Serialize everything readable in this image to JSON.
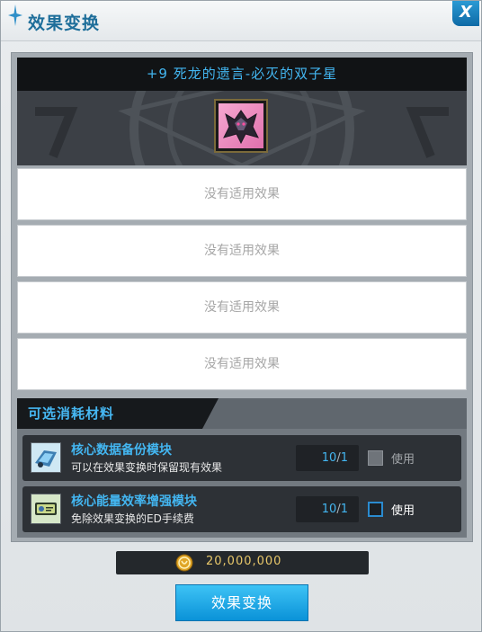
{
  "window": {
    "title": "效果变换",
    "close_label": "X"
  },
  "item": {
    "name": "+9 死龙的遗言-必灭的双子星",
    "icon": "dragon-emblem-icon"
  },
  "effect_slots": [
    {
      "text": "没有适用效果"
    },
    {
      "text": "没有适用效果"
    },
    {
      "text": "没有适用效果"
    },
    {
      "text": "没有适用效果"
    }
  ],
  "materials": {
    "title": "可选消耗材料",
    "items": [
      {
        "name": "核心数据备份模块",
        "description": "可以在效果变换时保留现有效果",
        "qty_have": "10",
        "qty_sep": "/",
        "qty_need": "1",
        "use_label": "使用",
        "checked": false,
        "enabled": false,
        "icon": "data-backup-module-icon"
      },
      {
        "name": "核心能量效率增强模块",
        "description": "免除效果变换的ED手续费",
        "qty_have": "10",
        "qty_sep": "/",
        "qty_need": "1",
        "use_label": "使用",
        "checked": false,
        "enabled": true,
        "icon": "energy-ticket-module-icon"
      }
    ]
  },
  "cost": {
    "icon": "ed-coin-icon",
    "amount": "20,000,000"
  },
  "action": {
    "label": "效果变换"
  },
  "colors": {
    "accent": "#43b6f1",
    "button": "#1aa8e8",
    "gold": "#e9c86a"
  }
}
